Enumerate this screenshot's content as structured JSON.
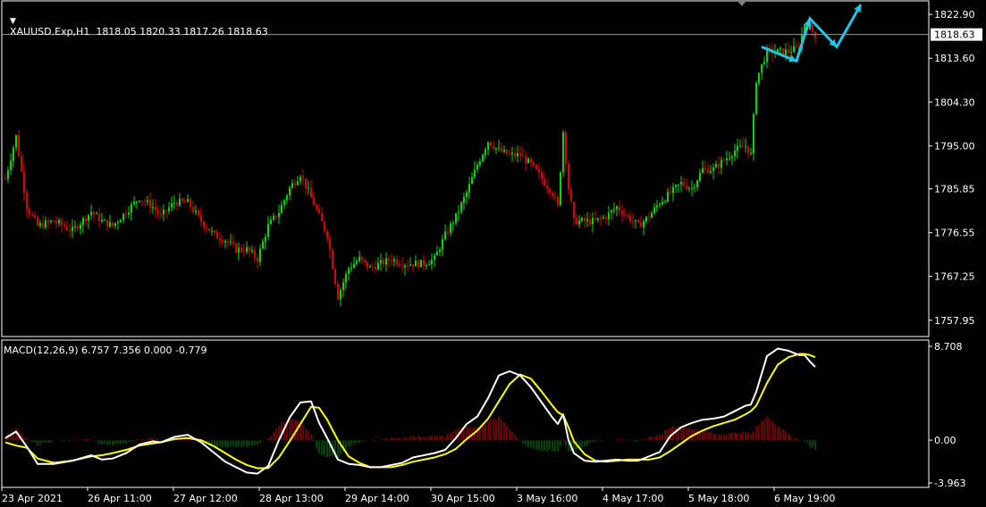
{
  "symbol_header": "XAUUSD.Exp,H1  1818.05 1820.33 1817.26 1818.63",
  "indicator_header": "MACD(12,26,9) 6.757 7.356 0.000 -0.779",
  "colors": {
    "background": "#000000",
    "frame": "#ffffff",
    "bull": "#00e000",
    "bear": "#e00000",
    "price_line": "#9a9a9a",
    "signal_line": "#ffff00",
    "macd_line": "#ffffff",
    "arrow": "#1ec8e6"
  },
  "chart_data": [
    {
      "type": "candlestick",
      "title": "XAUUSD.Exp,H1",
      "last_price_label": "1818.63",
      "ylim": [
        1754.5,
        1825.2
      ],
      "y_ticks": [
        "1822.90",
        "1813.60",
        "1804.30",
        "1795.00",
        "1785.85",
        "1776.55",
        "1767.25",
        "1757.95"
      ],
      "x_ticks": [
        "23 Apr 2021",
        "26 Apr 11:00",
        "27 Apr 12:00",
        "28 Apr 13:00",
        "29 Apr 14:00",
        "30 Apr 15:00",
        "3 May 16:00",
        "4 May 17:00",
        "5 May 18:00",
        "6 May 19:00"
      ],
      "close_path": [
        [
          0,
          1788
        ],
        [
          4,
          1797
        ],
        [
          8,
          1782
        ],
        [
          12,
          1778
        ],
        [
          18,
          1779
        ],
        [
          25,
          1777
        ],
        [
          32,
          1781
        ],
        [
          36,
          1779
        ],
        [
          40,
          1778
        ],
        [
          45,
          1781
        ],
        [
          50,
          1784
        ],
        [
          55,
          1782
        ],
        [
          58,
          1780
        ],
        [
          63,
          1783
        ],
        [
          68,
          1783
        ],
        [
          73,
          1779
        ],
        [
          78,
          1776
        ],
        [
          82,
          1775
        ],
        [
          86,
          1773
        ],
        [
          90,
          1773
        ],
        [
          94,
          1771
        ],
        [
          98,
          1778
        ],
        [
          102,
          1781
        ],
        [
          106,
          1786
        ],
        [
          110,
          1789
        ],
        [
          114,
          1784
        ],
        [
          117,
          1780
        ],
        [
          120,
          1776
        ],
        [
          124,
          1763
        ],
        [
          128,
          1769
        ],
        [
          132,
          1771
        ],
        [
          136,
          1769
        ],
        [
          140,
          1770
        ],
        [
          144,
          1771
        ],
        [
          148,
          1770
        ],
        [
          152,
          1770
        ],
        [
          156,
          1770
        ],
        [
          160,
          1771
        ],
        [
          164,
          1776
        ],
        [
          168,
          1780
        ],
        [
          172,
          1785
        ],
        [
          176,
          1791
        ],
        [
          180,
          1796
        ],
        [
          184,
          1794
        ],
        [
          188,
          1793
        ],
        [
          192,
          1793
        ],
        [
          196,
          1791
        ],
        [
          200,
          1788
        ],
        [
          204,
          1785
        ],
        [
          206,
          1782
        ],
        [
          208,
          1798
        ],
        [
          210,
          1786
        ],
        [
          212,
          1779
        ],
        [
          216,
          1779
        ],
        [
          220,
          1779
        ],
        [
          224,
          1780
        ],
        [
          228,
          1782
        ],
        [
          232,
          1780
        ],
        [
          236,
          1778
        ],
        [
          240,
          1780
        ],
        [
          244,
          1783
        ],
        [
          248,
          1785
        ],
        [
          252,
          1787
        ],
        [
          256,
          1786
        ],
        [
          260,
          1790
        ],
        [
          264,
          1790
        ],
        [
          268,
          1792
        ],
        [
          272,
          1794
        ],
        [
          276,
          1795
        ],
        [
          278,
          1793
        ],
        [
          280,
          1809
        ],
        [
          284,
          1815
        ],
        [
          288,
          1815
        ],
        [
          292,
          1815
        ],
        [
          296,
          1816
        ],
        [
          298,
          1821
        ],
        [
          300,
          1820
        ],
        [
          302,
          1818.6
        ]
      ]
    },
    {
      "type": "line",
      "title": "MACD(12,26,9)",
      "values_header": [
        "6.757",
        "7.356",
        "0.000",
        "-0.779"
      ],
      "ylim": [
        -3.963,
        8.708
      ],
      "y_ticks": [
        "8.708",
        "0.00",
        "-3.963"
      ],
      "series": [
        {
          "name": "MACD",
          "points": [
            [
              0,
              0.2
            ],
            [
              4,
              0.8
            ],
            [
              8,
              -0.6
            ],
            [
              12,
              -2.2
            ],
            [
              18,
              -2.2
            ],
            [
              25,
              -1.9
            ],
            [
              32,
              -1.4
            ],
            [
              36,
              -1.8
            ],
            [
              40,
              -1.7
            ],
            [
              45,
              -1.2
            ],
            [
              50,
              -0.4
            ],
            [
              55,
              -0.1
            ],
            [
              58,
              -0.2
            ],
            [
              63,
              0.3
            ],
            [
              68,
              0.5
            ],
            [
              73,
              -0.2
            ],
            [
              78,
              -1.2
            ],
            [
              82,
              -2.0
            ],
            [
              86,
              -2.5
            ],
            [
              90,
              -3.0
            ],
            [
              94,
              -3.1
            ],
            [
              98,
              -2.4
            ],
            [
              102,
              0.0
            ],
            [
              106,
              2.1
            ],
            [
              110,
              3.5
            ],
            [
              114,
              3.6
            ],
            [
              117,
              1.6
            ],
            [
              120,
              0.2
            ],
            [
              124,
              -1.8
            ],
            [
              128,
              -2.2
            ],
            [
              132,
              -2.3
            ],
            [
              136,
              -2.5
            ],
            [
              140,
              -2.5
            ],
            [
              144,
              -2.3
            ],
            [
              148,
              -2.1
            ],
            [
              152,
              -1.6
            ],
            [
              156,
              -1.4
            ],
            [
              160,
              -1.2
            ],
            [
              164,
              -0.9
            ],
            [
              168,
              0.2
            ],
            [
              172,
              1.5
            ],
            [
              176,
              2.2
            ],
            [
              180,
              3.9
            ],
            [
              184,
              6.0
            ],
            [
              188,
              6.4
            ],
            [
              192,
              6.0
            ],
            [
              196,
              4.9
            ],
            [
              200,
              3.5
            ],
            [
              204,
              2.1
            ],
            [
              206,
              1.5
            ],
            [
              208,
              2.4
            ],
            [
              210,
              0.0
            ],
            [
              212,
              -1.2
            ],
            [
              216,
              -1.9
            ],
            [
              220,
              -2.0
            ],
            [
              224,
              -1.9
            ],
            [
              228,
              -1.8
            ],
            [
              232,
              -1.9
            ],
            [
              236,
              -1.9
            ],
            [
              240,
              -1.5
            ],
            [
              244,
              -1.1
            ],
            [
              248,
              0.4
            ],
            [
              252,
              1.2
            ],
            [
              256,
              1.6
            ],
            [
              260,
              1.9
            ],
            [
              264,
              2.0
            ],
            [
              268,
              2.2
            ],
            [
              272,
              2.7
            ],
            [
              276,
              3.2
            ],
            [
              278,
              3.3
            ],
            [
              280,
              4.5
            ],
            [
              284,
              7.8
            ],
            [
              288,
              8.5
            ],
            [
              292,
              8.3
            ],
            [
              296,
              7.9
            ],
            [
              298,
              7.9
            ],
            [
              300,
              7.3
            ],
            [
              302,
              6.8
            ]
          ]
        },
        {
          "name": "Signal",
          "points": [
            [
              0,
              -0.2
            ],
            [
              4,
              -0.5
            ],
            [
              8,
              -0.7
            ],
            [
              12,
              -1.7
            ],
            [
              18,
              -2.1
            ],
            [
              25,
              -1.9
            ],
            [
              32,
              -1.5
            ],
            [
              36,
              -1.4
            ],
            [
              40,
              -1.2
            ],
            [
              45,
              -0.9
            ],
            [
              50,
              -0.5
            ],
            [
              55,
              -0.3
            ],
            [
              58,
              -0.2
            ],
            [
              63,
              0.1
            ],
            [
              68,
              0.2
            ],
            [
              73,
              0.0
            ],
            [
              78,
              -0.6
            ],
            [
              82,
              -1.2
            ],
            [
              86,
              -1.8
            ],
            [
              90,
              -2.3
            ],
            [
              94,
              -2.6
            ],
            [
              98,
              -2.6
            ],
            [
              102,
              -1.6
            ],
            [
              106,
              -0.1
            ],
            [
              110,
              1.5
            ],
            [
              114,
              3.1
            ],
            [
              117,
              3.0
            ],
            [
              120,
              1.9
            ],
            [
              124,
              0.0
            ],
            [
              128,
              -1.5
            ],
            [
              132,
              -2.1
            ],
            [
              136,
              -2.5
            ],
            [
              140,
              -2.5
            ],
            [
              144,
              -2.5
            ],
            [
              148,
              -2.3
            ],
            [
              152,
              -2.0
            ],
            [
              156,
              -1.8
            ],
            [
              160,
              -1.6
            ],
            [
              164,
              -1.3
            ],
            [
              168,
              -0.8
            ],
            [
              172,
              0.1
            ],
            [
              176,
              0.9
            ],
            [
              180,
              2.0
            ],
            [
              184,
              3.6
            ],
            [
              188,
              5.2
            ],
            [
              192,
              6.1
            ],
            [
              196,
              5.7
            ],
            [
              200,
              4.5
            ],
            [
              204,
              3.2
            ],
            [
              206,
              2.6
            ],
            [
              208,
              2.3
            ],
            [
              210,
              1.2
            ],
            [
              212,
              -0.1
            ],
            [
              216,
              -1.3
            ],
            [
              220,
              -1.9
            ],
            [
              224,
              -2.0
            ],
            [
              228,
              -1.9
            ],
            [
              232,
              -1.8
            ],
            [
              236,
              -1.8
            ],
            [
              240,
              -1.8
            ],
            [
              244,
              -1.6
            ],
            [
              248,
              -1.0
            ],
            [
              252,
              -0.3
            ],
            [
              256,
              0.4
            ],
            [
              260,
              0.9
            ],
            [
              264,
              1.3
            ],
            [
              268,
              1.6
            ],
            [
              272,
              1.9
            ],
            [
              276,
              2.4
            ],
            [
              278,
              2.7
            ],
            [
              280,
              3.2
            ],
            [
              284,
              5.3
            ],
            [
              288,
              7.0
            ],
            [
              292,
              7.7
            ],
            [
              296,
              8.0
            ],
            [
              298,
              8.0
            ],
            [
              300,
              7.9
            ],
            [
              302,
              7.7
            ]
          ]
        }
      ]
    }
  ]
}
